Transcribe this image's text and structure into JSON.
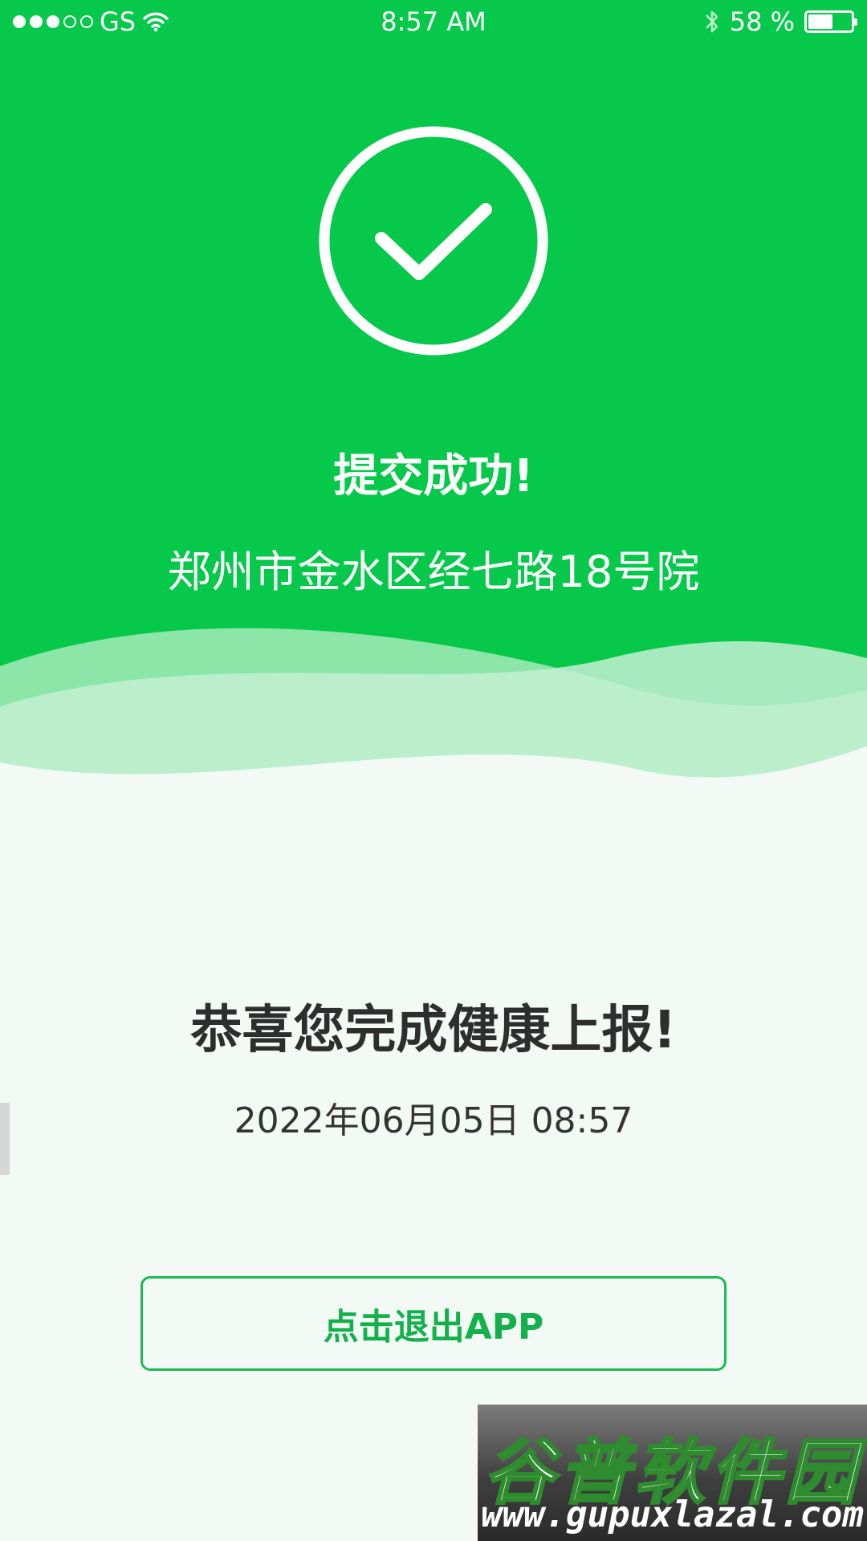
{
  "status_bar": {
    "carrier": "GS",
    "signal_bars_filled": 3,
    "signal_bars_total": 5,
    "time": "8:57 AM",
    "battery_text": "58 %",
    "battery_level": 0.58
  },
  "result": {
    "title": "提交成功!",
    "address": "郑州市金水区经七路18号院"
  },
  "congrats": "恭喜您完成健康上报!",
  "datetime": "2022年06月05日 08:57",
  "exit_button_label": "点击退出APP",
  "watermark": {
    "title": "谷普软件园",
    "url": "www.gupuxlazal.com"
  },
  "colors": {
    "primary_green": "#06c84a",
    "button_green": "#1db954",
    "background": "#f3faf6"
  },
  "icons": [
    "check-circle-icon",
    "wifi-icon",
    "bluetooth-icon",
    "battery-icon"
  ]
}
